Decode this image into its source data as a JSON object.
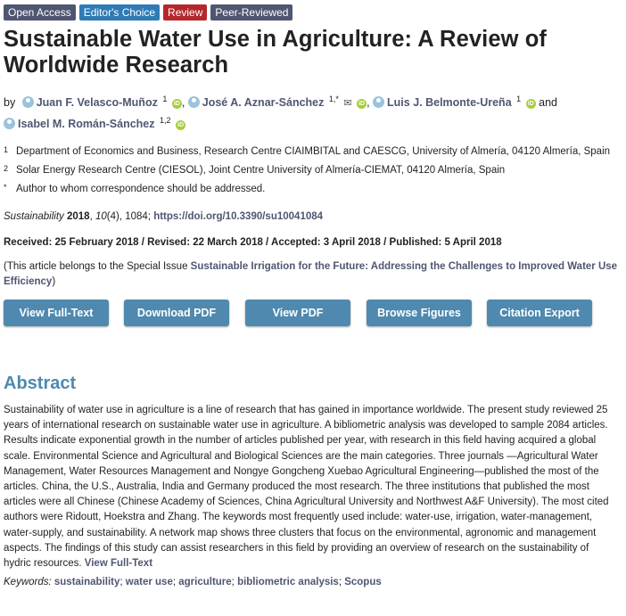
{
  "badges": [
    "Open Access",
    "Editor's Choice",
    "Review",
    "Peer-Reviewed"
  ],
  "title": "Sustainable Water Use in Agriculture: A Review of Worldwide Research",
  "authors": {
    "by": "by",
    "list": [
      {
        "name": "Juan F. Velasco-Muñoz",
        "sup": "1"
      },
      {
        "name": "José A. Aznar-Sánchez",
        "sup": "1,*"
      },
      {
        "name": "Luis J. Belmonte-Ureña",
        "sup": "1"
      },
      {
        "name": "Isabel M. Román-Sánchez",
        "sup": "1,2"
      }
    ],
    "and": "and",
    "orcid_label": "iD",
    "mail_icon": "✉"
  },
  "affiliations": [
    {
      "num": "1",
      "text": "Department of Economics and Business, Research Centre CIAIMBITAL and CAESCG, University of Almería, 04120 Almería, Spain"
    },
    {
      "num": "2",
      "text": "Solar Energy Research Centre (CIESOL), Joint Centre University of Almería-CIEMAT, 04120 Almería, Spain"
    },
    {
      "num": "*",
      "text": "Author to whom correspondence should be addressed."
    }
  ],
  "citation": {
    "journal": "Sustainability",
    "year": "2018",
    "volume": "10",
    "issue": "(4)",
    "article": ", 1084; ",
    "doi": "https://doi.org/10.3390/su10041084"
  },
  "dates": "Received: 25 February 2018 / Revised: 22 March 2018 / Accepted: 3 April 2018 / Published: 5 April 2018",
  "special_issue": {
    "prefix": "(This article belongs to the Special Issue ",
    "link": "Sustainable Irrigation for the Future: Addressing the Challenges to Improved Water Use Efficiency",
    "suffix": ")"
  },
  "buttons": [
    "View Full-Text",
    "Download PDF",
    "View PDF",
    "Browse Figures",
    "Citation Export"
  ],
  "abstract": {
    "heading": "Abstract",
    "text": "Sustainability of water use in agriculture is a line of research that has gained in importance worldwide. The present study reviewed 25 years of international research on sustainable water use in agriculture. A bibliometric analysis was developed to sample 2084 articles. Results indicate exponential growth in the number of articles published per year, with research in this field having acquired a global scale. Environmental Science and Agricultural and Biological Sciences are the main categories. Three journals —Agricultural Water Management, Water Resources Management and Nongye Gongcheng Xuebao Agricultural Engineering—published the most of the articles. China, the U.S., Australia, India and Germany produced the most research. The three institutions that published the most articles were all Chinese (Chinese Academy of Sciences, China Agricultural University and Northwest A&F University). The most cited authors were Ridoutt, Hoekstra and Zhang. The keywords most frequently used include: water-use, irrigation, water-management, water-supply, and sustainability. A network map shows three clusters that focus on the environmental, agronomic and management aspects. The findings of this study can assist researchers in this field by providing an overview of research on the sustainability of hydric resources.",
    "full_text_link": "View Full-Text"
  },
  "keywords": {
    "label": "Keywords:",
    "items": [
      "sustainability",
      "water use",
      "agriculture",
      "bibliometric analysis",
      "Scopus"
    ]
  }
}
